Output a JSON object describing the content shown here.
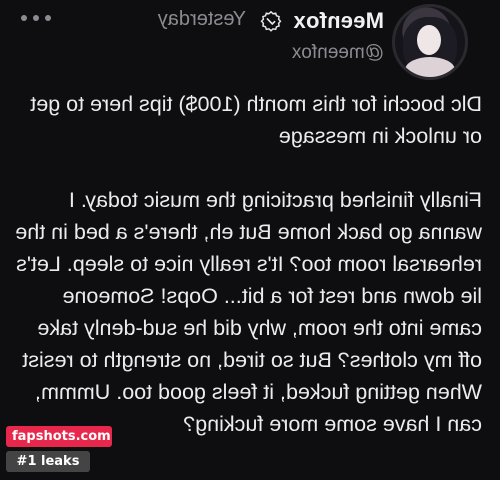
{
  "post": {
    "author_name": "Meenfox",
    "author_handle": "@meenfox",
    "timestamp": "Yesterday",
    "text": "Dlc bocchi for this month (100$) tips here to get or unlock in message\n\nFinally finished practicing the music today. I wanna go back home But eh, there's a bed in the rehearsal room too? It's really nice to sleep. Let's lie down and rest for a bit... Oops! Someone came into the room, why did he sud-denly take off my clothes? But so tired, no strength to resist When getting fucked, it feels good too. Ummm, can I have some more fucking?"
  },
  "icons": {
    "verified": "verified-badge-icon",
    "more": "more-options-icon"
  },
  "watermark": {
    "site": "fapshots.com",
    "tag": "#1 leaks"
  },
  "colors": {
    "background": "#0e0e10",
    "text": "#ececee",
    "muted": "#8b8b92",
    "watermark_red": "#e7274b"
  }
}
